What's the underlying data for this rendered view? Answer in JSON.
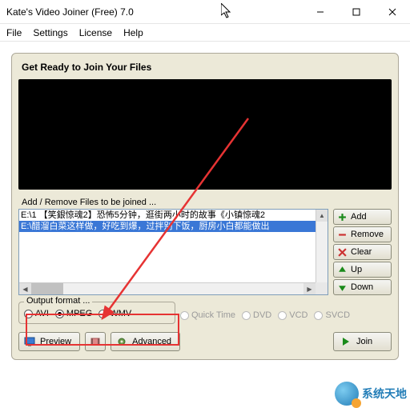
{
  "window": {
    "title": "Kate's Video Joiner (Free) 7.0"
  },
  "menu": {
    "file": "File",
    "settings": "Settings",
    "license": "License",
    "help": "Help"
  },
  "panel": {
    "heading": "Get Ready to Join Your Files",
    "list_label": "Add / Remove Files to be joined ...",
    "items": [
      "E:\\1 【笑銀惊魂2】恐怖5分钟，逛街两小时的故事《小镇惊魂2",
      "E:\\醋溜白菜这样做，好吃到爆，过拌别下饭，厨房小白都能做出"
    ],
    "selected_index": 1
  },
  "buttons": {
    "add": "Add",
    "remove": "Remove",
    "clear": "Clear",
    "up": "Up",
    "down": "Down"
  },
  "format": {
    "label": "Output format ...",
    "avi": "AVI",
    "mpeg": "MPEG",
    "wmv": "WMV",
    "quicktime": "Quick Time",
    "dvd": "DVD",
    "vcd": "VCD",
    "svcd": "SVCD",
    "selected": "mpeg"
  },
  "bottom": {
    "preview": "Preview",
    "advanced": "Advanced",
    "join": "Join"
  },
  "watermark": {
    "text": "系统天地"
  }
}
